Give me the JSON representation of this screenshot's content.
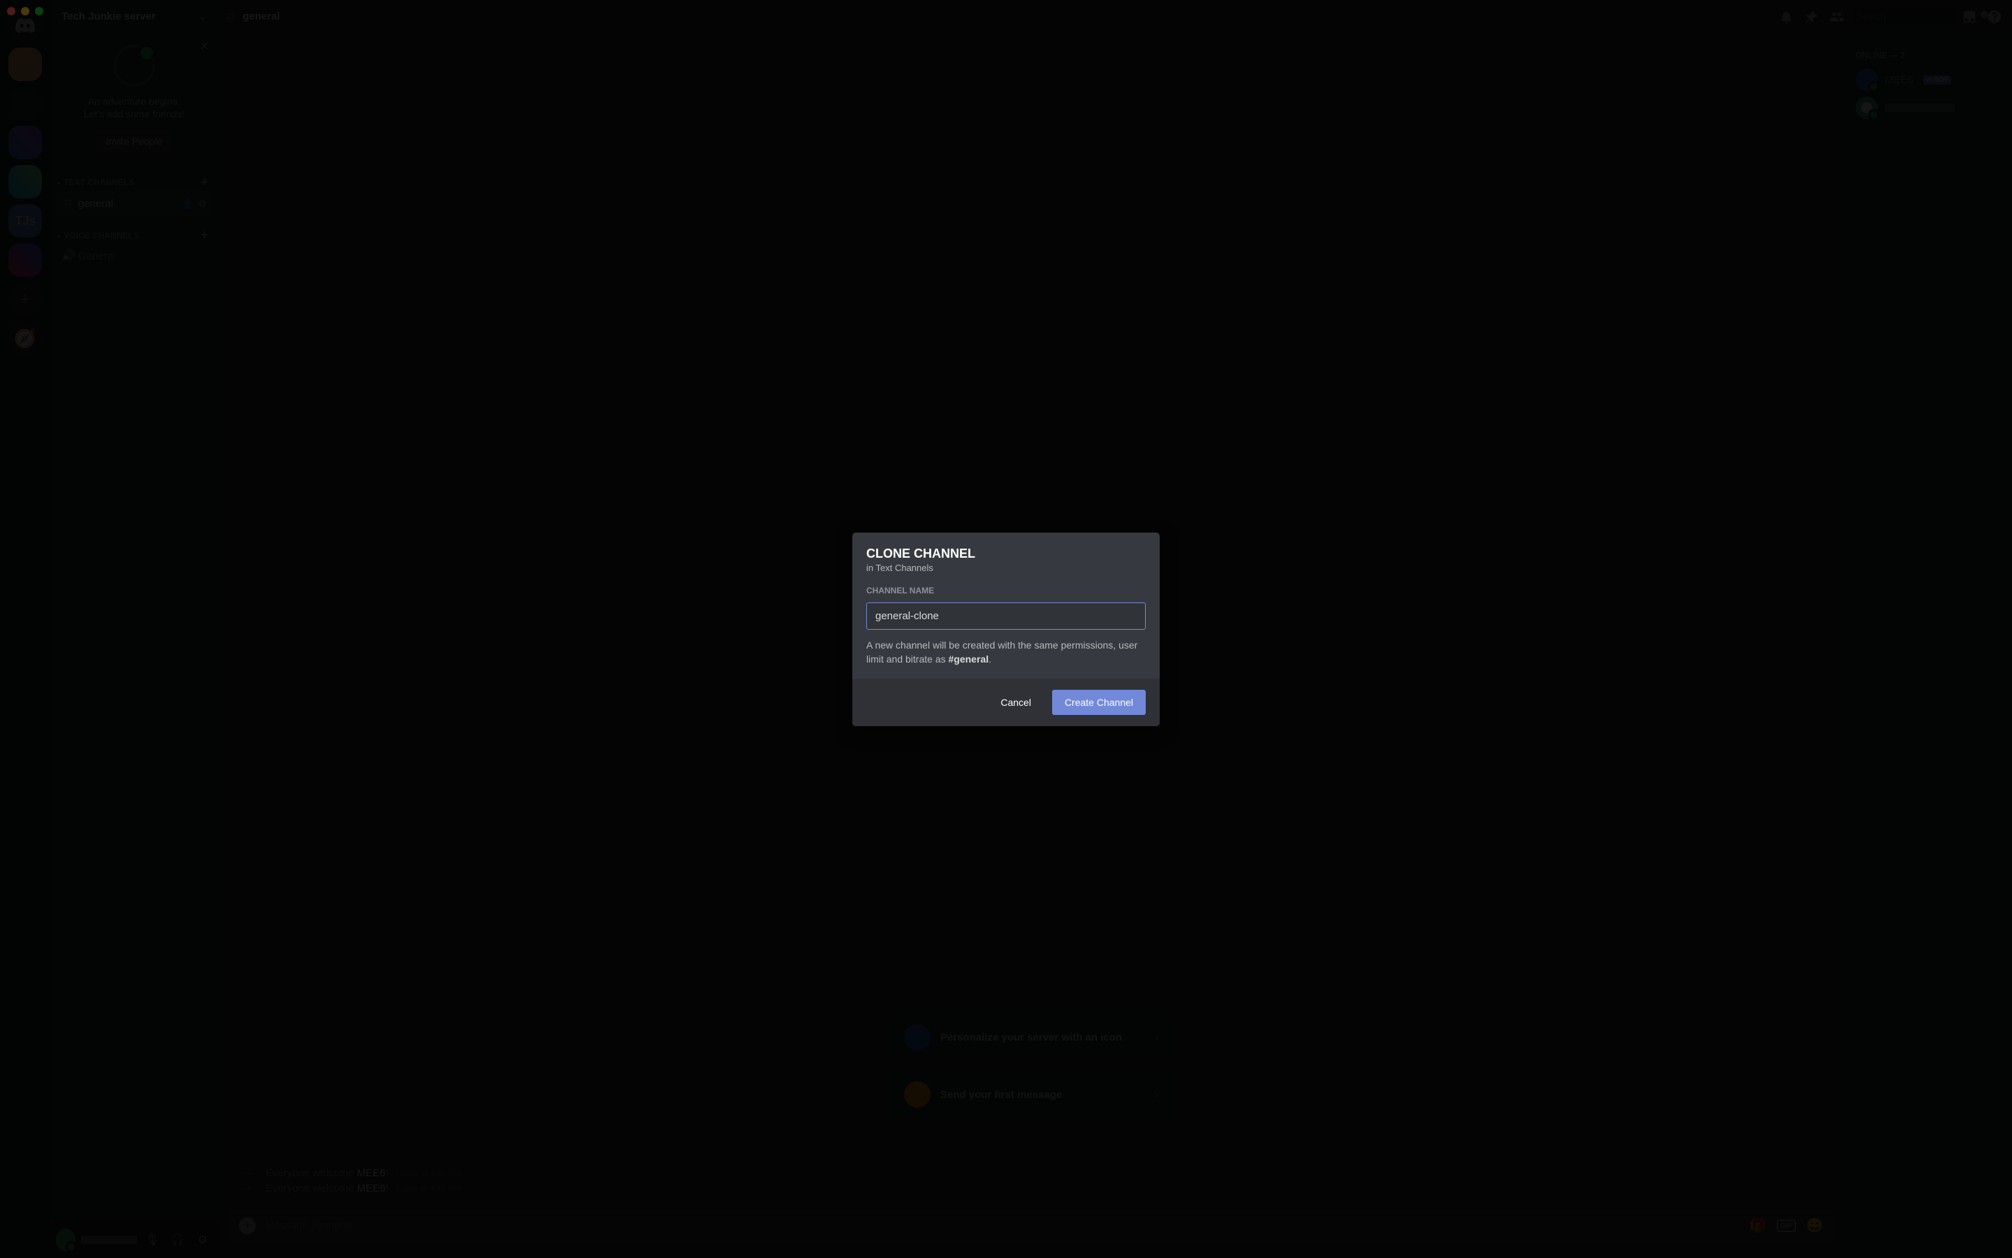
{
  "server": {
    "name": "Tech Junkie server",
    "selected_guild_initials": "TJs"
  },
  "welcome": {
    "line1": "An adventure begins.",
    "line2": "Let's add some friends!",
    "invite_button": "Invite People"
  },
  "categories": {
    "text": {
      "label": "Text Channels"
    },
    "voice": {
      "label": "Voice Channels"
    }
  },
  "channels": {
    "text": [
      {
        "name": "general",
        "active": true
      }
    ],
    "voice": [
      {
        "name": "General"
      }
    ]
  },
  "topbar": {
    "channel": "general",
    "search_placeholder": "Search"
  },
  "steps": {
    "personalize": "Personalize your server with an icon",
    "first_message": "Send your first message"
  },
  "messages": [
    {
      "prefix": "Everyone welcome ",
      "who": "MEE6",
      "suffix": "!",
      "ts": "Today at 4:38 PM"
    },
    {
      "prefix": "Everyone welcome ",
      "who": "MEE6",
      "suffix": "!",
      "ts": "Today at 4:39 PM"
    }
  ],
  "composer": {
    "placeholder": "Message #general"
  },
  "members": {
    "header": "ONLINE — 2",
    "list": [
      {
        "name": "MEE6",
        "bot": true,
        "bot_label": "✔ BOT"
      }
    ]
  },
  "modal": {
    "title": "Clone Channel",
    "subtitle": "in Text Channels",
    "field_label": "Channel Name",
    "input_value": "general-clone",
    "help_prefix": "A new channel will be created with the same permissions, user limit and bitrate as ",
    "help_channel": "#general",
    "help_suffix": ".",
    "cancel": "Cancel",
    "confirm": "Create Channel"
  }
}
